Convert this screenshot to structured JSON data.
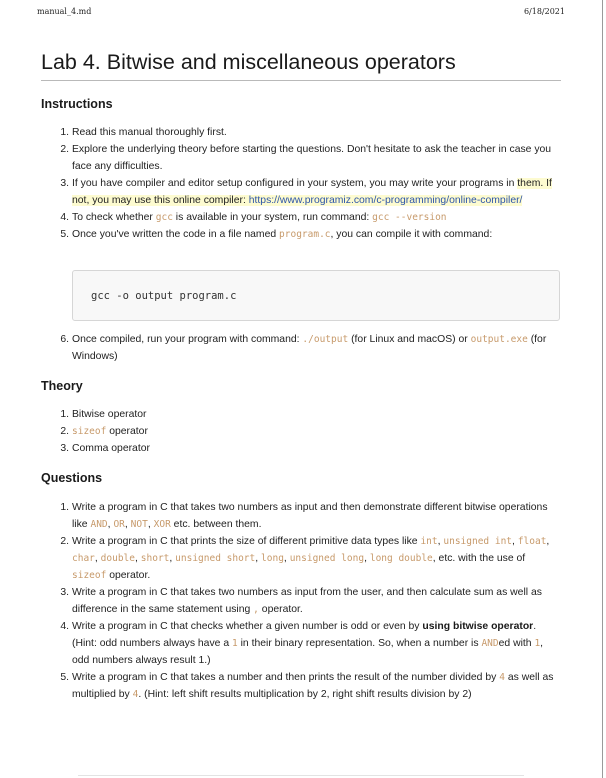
{
  "header": {
    "filename": "manual_4.md",
    "date": "6/18/2021"
  },
  "title": "Lab 4. Bitwise and miscellaneous operators",
  "instructions": {
    "heading": "Instructions",
    "n1": "1.",
    "n2": "2.",
    "n3": "3.",
    "n4": "4.",
    "n5": "5.",
    "n6": "6.",
    "i1": "Read this manual thoroughly first.",
    "i2": "Explore the underlying theory before starting the questions. Don't hesitate to ask the teacher in case you face any difficulties.",
    "i3_a": "If you have compiler and editor setup configured in your system, you may write your programs in ",
    "i3_b": "them. If not, you may use this online compiler: ",
    "i3_link": "https://www.programiz.com/c-programming/online-compiler/",
    "i4_a": "To check whether ",
    "i4_code1": "gcc",
    "i4_b": " is available in your system, run command: ",
    "i4_code2": "gcc --version",
    "i5_a": "Once you've written the code in a file named ",
    "i5_code": "program.c",
    "i5_b": ", you can compile it with command:",
    "code_block": "gcc -o output program.c",
    "i6_a": "Once compiled, run your program with command: ",
    "i6_code1": "./output",
    "i6_b": " (for Linux and macOS) or ",
    "i6_code2": "output.exe",
    "i6_c": " (for Windows)"
  },
  "theory": {
    "heading": "Theory",
    "n1": "1.",
    "n2": "2.",
    "n3": "3.",
    "t1": "Bitwise operator",
    "t2_code": "sizeof",
    "t2": " operator",
    "t3": "Comma operator"
  },
  "questions": {
    "heading": "Questions",
    "n1": "1.",
    "n2": "2.",
    "n3": "3.",
    "n4": "4.",
    "n5": "5.",
    "q1_a": "Write a program in C that takes two numbers as input and then demonstrate different bitwise operations like ",
    "q1_and": "AND",
    "q1_or": "OR",
    "q1_not": "NOT",
    "q1_xor": "XOR",
    "q1_b": " etc. between them.",
    "q2_a": "Write a program in C that prints the size of different primitive data types like ",
    "q2_int": "int",
    "q2_uint": "unsigned int",
    "q2_float": "float",
    "q2_char": "char",
    "q2_double": "double",
    "q2_short": "short",
    "q2_ushort": "unsigned short",
    "q2_long": "long",
    "q2_ulong": "unsigned long",
    "q2_ldouble": "long double",
    "q2_b": ", etc. with the use of ",
    "q2_sizeof": "sizeof",
    "q2_c": " operator.",
    "q3_a": "Write a program in C that takes two numbers as input from the user, and then calculate sum as well as difference in the same statement using ",
    "q3_comma": ",",
    "q3_b": " operator.",
    "q4_a": "Write a program in C that checks whether a given number is odd or even by ",
    "q4_bold": "using bitwise operator",
    "q4_b": ". (Hint: odd numbers always have a ",
    "q4_one": "1",
    "q4_c": " in their binary representation. So, when a number is ",
    "q4_and": "AND",
    "q4_d": "ed with ",
    "q4_one2": "1",
    "q4_e": ", odd numbers always result 1.)",
    "q5_a": "Write a program in C that takes a number and then prints the result of the number divided by ",
    "q5_four": "4",
    "q5_b": " as well as multiplied by ",
    "q5_four2": "4",
    "q5_c": ". (Hint: left shift results multiplication by 2, right shift results division by 2)"
  }
}
